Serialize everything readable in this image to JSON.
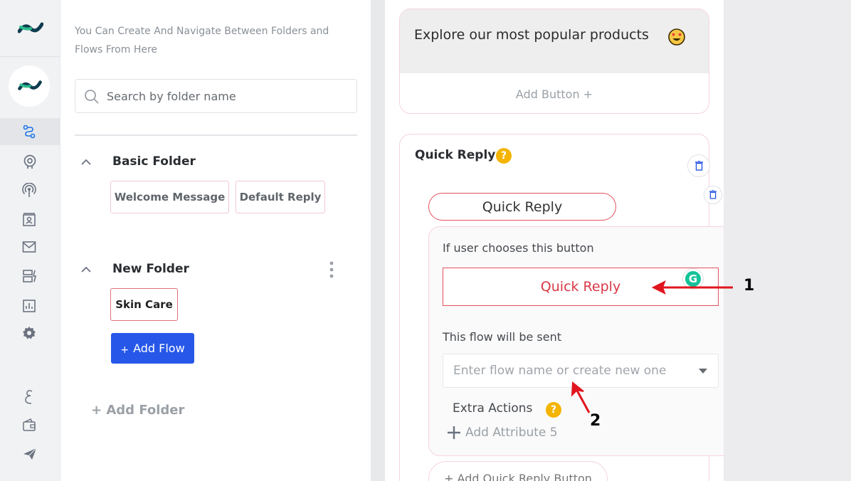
{
  "colors": {
    "brand_blue": "#2657e8",
    "accent_red": "#e1525c",
    "help_yellow": "#f4b400",
    "annotation_red": "#e0151e"
  },
  "sidebar": {
    "icons": [
      "brand-logo-icon",
      "workspace-avatar-icon",
      "flows-icon",
      "bot-icon",
      "broadcast-icon",
      "contacts-icon",
      "mail-icon",
      "templates-icon",
      "analytics-icon",
      "settings-icon",
      "arabic-language-icon",
      "wallet-icon",
      "send-icon"
    ]
  },
  "folders_panel": {
    "description": "You Can Create And Navigate Between Folders and Flows From Here",
    "search": {
      "placeholder": "Search by folder name",
      "value": ""
    },
    "folders": [
      {
        "name": "Basic Folder",
        "flows": [
          "Welcome Message",
          "Default Reply"
        ]
      },
      {
        "name": "New Folder",
        "flows": [
          "Skin Care"
        ]
      }
    ],
    "add_flow_label": "Add Flow",
    "add_flow_plus": "+",
    "add_folder_label": "+ Add Folder"
  },
  "editor": {
    "message_text": "Explore our most popular products",
    "add_button_label": "Add Button +",
    "quick_reply_section_title": "Quick Reply",
    "help_glyph": "?",
    "quick_reply_pill_label": "Quick Reply",
    "if_user_chooses_label": "If user chooses this button",
    "quick_reply_input_value": "Quick Reply",
    "grammarly_glyph": "G",
    "flow_sent_label": "This flow will be sent",
    "flow_select_placeholder": "Enter flow name or create new one",
    "extra_actions_label": "Extra Actions",
    "add_attribute_label": "Add Attribute 5",
    "add_quick_reply_button_label": "+ Add Quick Reply Button"
  },
  "annotations": [
    "1",
    "2"
  ]
}
